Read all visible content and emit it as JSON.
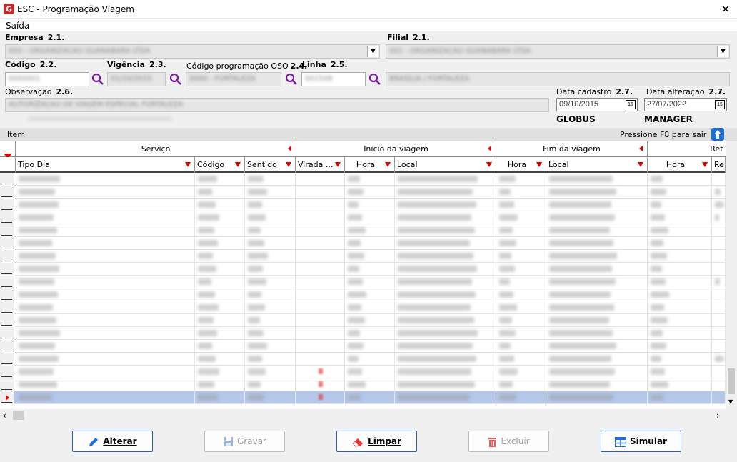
{
  "window": {
    "title": "ESC - Programação Viagem"
  },
  "menu": {
    "items": [
      "Saída"
    ]
  },
  "form": {
    "empresa": {
      "label": "Empresa",
      "code": "2.1."
    },
    "filial": {
      "label": "Filial",
      "code": "2.1."
    },
    "codigo": {
      "label": "Código",
      "code": "2.2."
    },
    "vigencia": {
      "label": "Vigência",
      "code": "2.3."
    },
    "codigo_oso": {
      "label": "Código programação OSO",
      "code": "2.4."
    },
    "linha": {
      "label": "Linha",
      "code": "2.5."
    },
    "observacao": {
      "label": "Observação",
      "code": "2.6."
    },
    "data_cadastro": {
      "label": "Data cadastro",
      "code": "2.7.",
      "value": "09/10/2015",
      "user": "GLOBUS"
    },
    "data_alteracao": {
      "label": "Data alteração",
      "code": "2.7.",
      "value": "27/07/2022",
      "user": "MANAGER"
    }
  },
  "item_bar": {
    "label": "Item",
    "hint": "Pressione F8 para sair"
  },
  "grid": {
    "groups": [
      "Serviço",
      "Inicio da viagem",
      "Fim da viagem",
      "Ref"
    ],
    "columns": [
      "Tipo Dia",
      "Código",
      "Sentido",
      "Virada ...",
      "Hora",
      "Local",
      "Hora",
      "Local",
      "Hora",
      "Re"
    ],
    "row_count": 18,
    "selected_row": 18
  },
  "buttons": {
    "alterar": "Alterar",
    "gravar": "Gravar",
    "limpar": "Limpar",
    "excluir": "Excluir",
    "simular": "Simular"
  },
  "colors": {
    "accent": "#2b5fab",
    "search": "#7b1fa2",
    "filter": "#e00000",
    "selected": "#b5c8ea"
  }
}
